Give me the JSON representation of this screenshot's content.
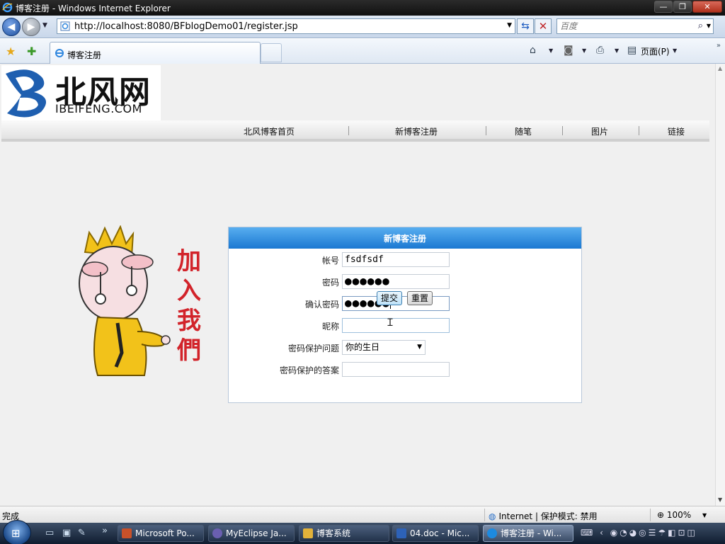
{
  "window": {
    "title": "博客注册 - Windows Internet Explorer",
    "minimize_glyph": "—",
    "maximize_glyph": "❐",
    "close_glyph": "✕"
  },
  "navigation": {
    "url": "http://localhost:8080/BFblogDemo01/register.jsp",
    "search_placeholder": "百度"
  },
  "tabs": [
    {
      "label": "博客注册",
      "active": true
    }
  ],
  "commandbar": {
    "page_label": "页面(P)"
  },
  "site": {
    "logo_cn": "北风网",
    "logo_en": "IBEIFENG.COM",
    "menu": [
      {
        "label": "北风博客首页"
      },
      {
        "label": "新博客注册"
      },
      {
        "label": "随笔"
      },
      {
        "label": "图片"
      },
      {
        "label": "链接"
      }
    ],
    "join_text": [
      "加",
      "入",
      "我",
      "們"
    ]
  },
  "register_form": {
    "title": "新博客注册",
    "account": {
      "label": "帐号",
      "value": "fsdfsdf"
    },
    "password": {
      "label": "密码",
      "value": "●●●●●●"
    },
    "confirm_password": {
      "label": "确认密码",
      "value": "●●●●●●"
    },
    "nickname": {
      "label": "昵称",
      "value": ""
    },
    "security_question": {
      "label": "密码保护问题",
      "selected": "你的生日"
    },
    "security_answer": {
      "label": "密码保护的答案",
      "value": ""
    },
    "submit_label": "提交",
    "reset_label": "重置"
  },
  "statusbar": {
    "status": "完成",
    "zone": "Internet | 保护模式: 禁用",
    "zoom": "100%"
  },
  "taskbar": {
    "tasks": [
      {
        "label": "Microsoft Po...",
        "color": "#c8512a"
      },
      {
        "label": "MyEclipse Ja...",
        "color": "#6a5fb0"
      },
      {
        "label": "博客系统",
        "color": "#e2b23a"
      },
      {
        "label": "04.doc - Mic...",
        "color": "#2d62b8"
      },
      {
        "label": "博客注册 - Wi...",
        "color": "#1c8ae0",
        "active": true
      }
    ]
  },
  "colors": {
    "form_header": "#1b78d2",
    "accent_red": "#d2232a"
  }
}
